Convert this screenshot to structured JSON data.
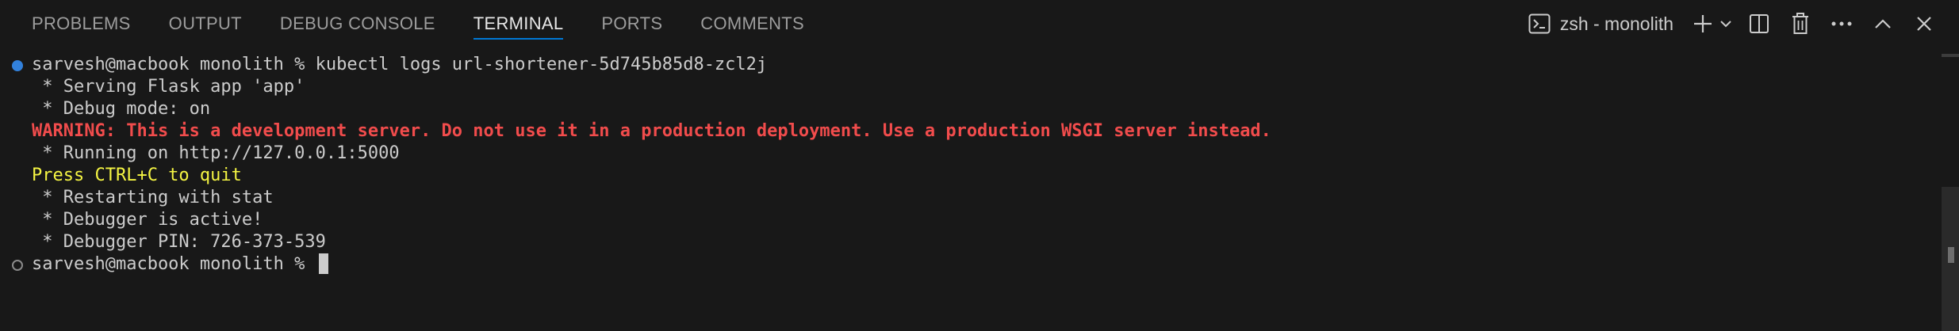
{
  "tabs": [
    {
      "label": "PROBLEMS"
    },
    {
      "label": "OUTPUT"
    },
    {
      "label": "DEBUG CONSOLE"
    },
    {
      "label": "TERMINAL"
    },
    {
      "label": "PORTS"
    },
    {
      "label": "COMMENTS"
    }
  ],
  "active_tab": "TERMINAL",
  "terminal_selector": {
    "label": "zsh - monolith",
    "icon": "terminal-icon"
  },
  "actions": [
    {
      "name": "new-terminal",
      "icon": "plus-icon"
    },
    {
      "name": "launch-profile",
      "icon": "chevron-down-icon"
    },
    {
      "name": "split-terminal",
      "icon": "split-icon"
    },
    {
      "name": "kill-terminal",
      "icon": "trash-icon"
    },
    {
      "name": "more-actions",
      "icon": "ellipsis-icon"
    },
    {
      "name": "maximize-panel",
      "icon": "chevron-up-icon"
    },
    {
      "name": "close-panel",
      "icon": "close-icon"
    }
  ],
  "terminal": {
    "lines": [
      {
        "text": "sarvesh@macbook monolith % kubectl logs url-shortener-5d745b85d8-zcl2j",
        "style": "normal",
        "marker": "filled"
      },
      {
        "text": " * Serving Flask app 'app'",
        "style": "normal"
      },
      {
        "text": " * Debug mode: on",
        "style": "normal"
      },
      {
        "text": "WARNING: This is a development server. Do not use it in a production deployment. Use a production WSGI server instead.",
        "style": "warn"
      },
      {
        "text": " * Running on http://127.0.0.1:5000",
        "style": "normal"
      },
      {
        "text": "Press CTRL+C to quit",
        "style": "yellow"
      },
      {
        "text": " * Restarting with stat",
        "style": "normal"
      },
      {
        "text": " * Debugger is active!",
        "style": "normal"
      },
      {
        "text": " * Debugger PIN: 726-373-539",
        "style": "normal"
      },
      {
        "text": "sarvesh@macbook monolith % ",
        "style": "normal",
        "marker": "hollow",
        "cursor": true
      }
    ]
  },
  "colors": {
    "background": "#181818",
    "text": "#cccccc",
    "warning": "#f14c4c",
    "highlight_yellow": "#f5f543",
    "accent": "#0078d4"
  }
}
